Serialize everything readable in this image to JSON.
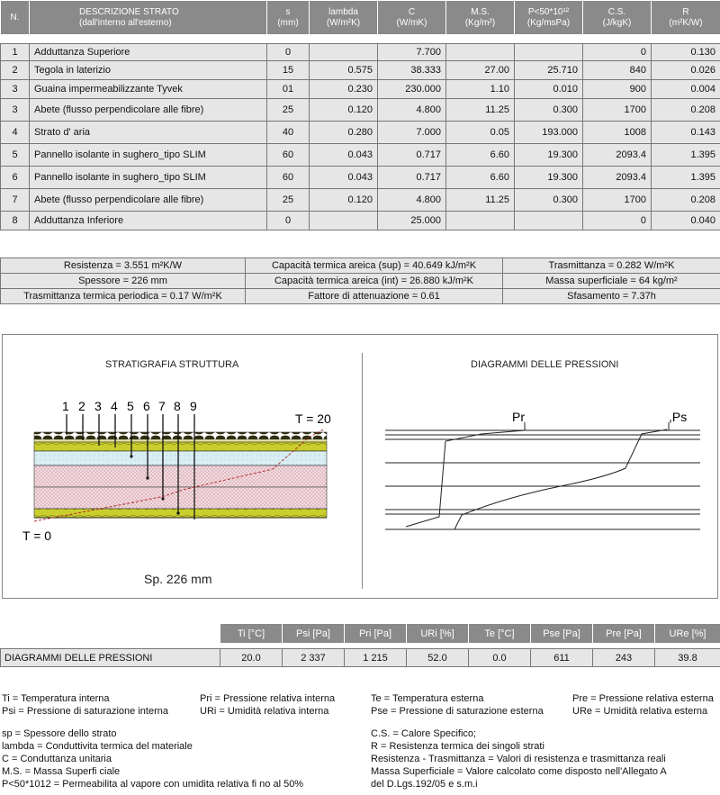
{
  "layers": {
    "headers": [
      [
        "N.",
        ""
      ],
      [
        "DESCRIZIONE STRATO",
        "(dall'interno all'esterno)"
      ],
      [
        "s",
        "(mm)"
      ],
      [
        "lambda",
        "(W/m²K)"
      ],
      [
        "C",
        "(W/mK)"
      ],
      [
        "M.S.",
        "(Kg/m²)"
      ],
      [
        "P<50*10¹²",
        "(Kg/msPa)"
      ],
      [
        "C.S.",
        "(J/kgK)"
      ],
      [
        "R",
        "(m²K/W)"
      ]
    ],
    "rows": [
      [
        "1",
        "Adduttanza Superiore",
        "0",
        "",
        "7.700",
        "",
        "",
        "0",
        "0.130"
      ],
      [
        "2",
        "Tegola in laterizio",
        "15",
        "0.575",
        "38.333",
        "27.00",
        "25.710",
        "840",
        "0.026"
      ],
      [
        "3",
        "Guaina impermeabilizzante Tyvek",
        "01",
        "0.230",
        "230.000",
        "1.10",
        "0.010",
        "900",
        "0.004"
      ],
      [
        "3",
        "Abete (flusso perpendicolare alle fibre)",
        "25",
        "0.120",
        "4.800",
        "11.25",
        "0.300",
        "1700",
        "0.208"
      ],
      [
        "4",
        "Strato d' aria",
        "40",
        "0.280",
        "7.000",
        "0.05",
        "193.000",
        "1008",
        "0.143"
      ],
      [
        "5",
        "Pannello isolante in sughero_tipo SLIM",
        "60",
        "0.043",
        "0.717",
        "6.60",
        "19.300",
        "2093.4",
        "1.395"
      ],
      [
        "6",
        "Pannello isolante in sughero_tipo SLIM",
        "60",
        "0.043",
        "0.717",
        "6.60",
        "19.300",
        "2093.4",
        "1.395"
      ],
      [
        "7",
        "Abete (flusso perpendicolare alle fibre)",
        "25",
        "0.120",
        "4.800",
        "11.25",
        "0.300",
        "1700",
        "0.208"
      ],
      [
        "8",
        "Adduttanza Inferiore",
        "0",
        "",
        "25.000",
        "",
        "",
        "0",
        "0.040"
      ]
    ]
  },
  "summary": {
    "rows": [
      [
        "Resistenza = 3.551 m²K/W",
        "Capacità termica areica (sup) = 40.649 kJ/m²K",
        "Trasmittanza = 0.282 W/m²K"
      ],
      [
        "Spessore = 226 mm",
        "Capacità termica areica (int) = 26.880 kJ/m²K",
        "Massa superficiale = 64 kg/m²"
      ],
      [
        "Trasmittanza termica periodica = 0.17 W/m²K",
        "Fattore di attenuazione = 0.61",
        "Sfasamento = 7.37h"
      ]
    ]
  },
  "diagrams": {
    "left_title": "STRATIGRAFIA STRUTTURA",
    "right_title": "DIAGRAMMI DELLE PRESSIONI",
    "layer_numbers": [
      "1",
      "2",
      "3",
      "4",
      "5",
      "6",
      "7",
      "8",
      "9"
    ],
    "t_top": "T = 20",
    "t_bottom": "T = 0",
    "thickness_label": "Sp. 226 mm",
    "pr_label": "Pr",
    "ps_label": ",Ps"
  },
  "pressures": {
    "headers": [
      "Ti [°C]",
      "Psi [Pa]",
      "Pri [Pa]",
      "URi [%]",
      "Te [°C]",
      "Pse [Pa]",
      "Pre [Pa]",
      "URe [%]"
    ],
    "row_label": "DIAGRAMMI DELLE PRESSIONI",
    "values": [
      "20.0",
      "2 337",
      "1 215",
      "52.0",
      "0.0",
      "611",
      "243",
      "39.8"
    ]
  },
  "legend": {
    "col1": [
      "Ti = Temperatura interna",
      "Psi = Pressione di saturazione interna"
    ],
    "col2": [
      "Pri = Pressione relativa interna",
      "URi = Umidità relativa interna"
    ],
    "col3": [
      "Te = Temperatura esterna",
      "Pse = Pressione di saturazione esterna"
    ],
    "col4": [
      "Pre = Pressione relativa esterna",
      "URe = Umidità relativa esterna"
    ],
    "notes_left": [
      "sp = Spessore dello strato",
      "lambda = Conduttivita termica del materiale",
      "C = Conduttanza unitaria",
      "M.S. = Massa Superfi ciale",
      "P<50*1012 = Permeabilita al vapore con umidita relativa fi no al 50%"
    ],
    "notes_right": [
      "C.S. = Calore Specifico;",
      "R = Resistenza termica dei singoli strati",
      "Resistenza - Trasmittanza = Valori di resistenza e trasmittanza reali",
      "Massa Superficiale = Valore calcolato come disposto nell'Allegato A",
      "del D.Lgs.192/05 e s.m.i"
    ]
  }
}
